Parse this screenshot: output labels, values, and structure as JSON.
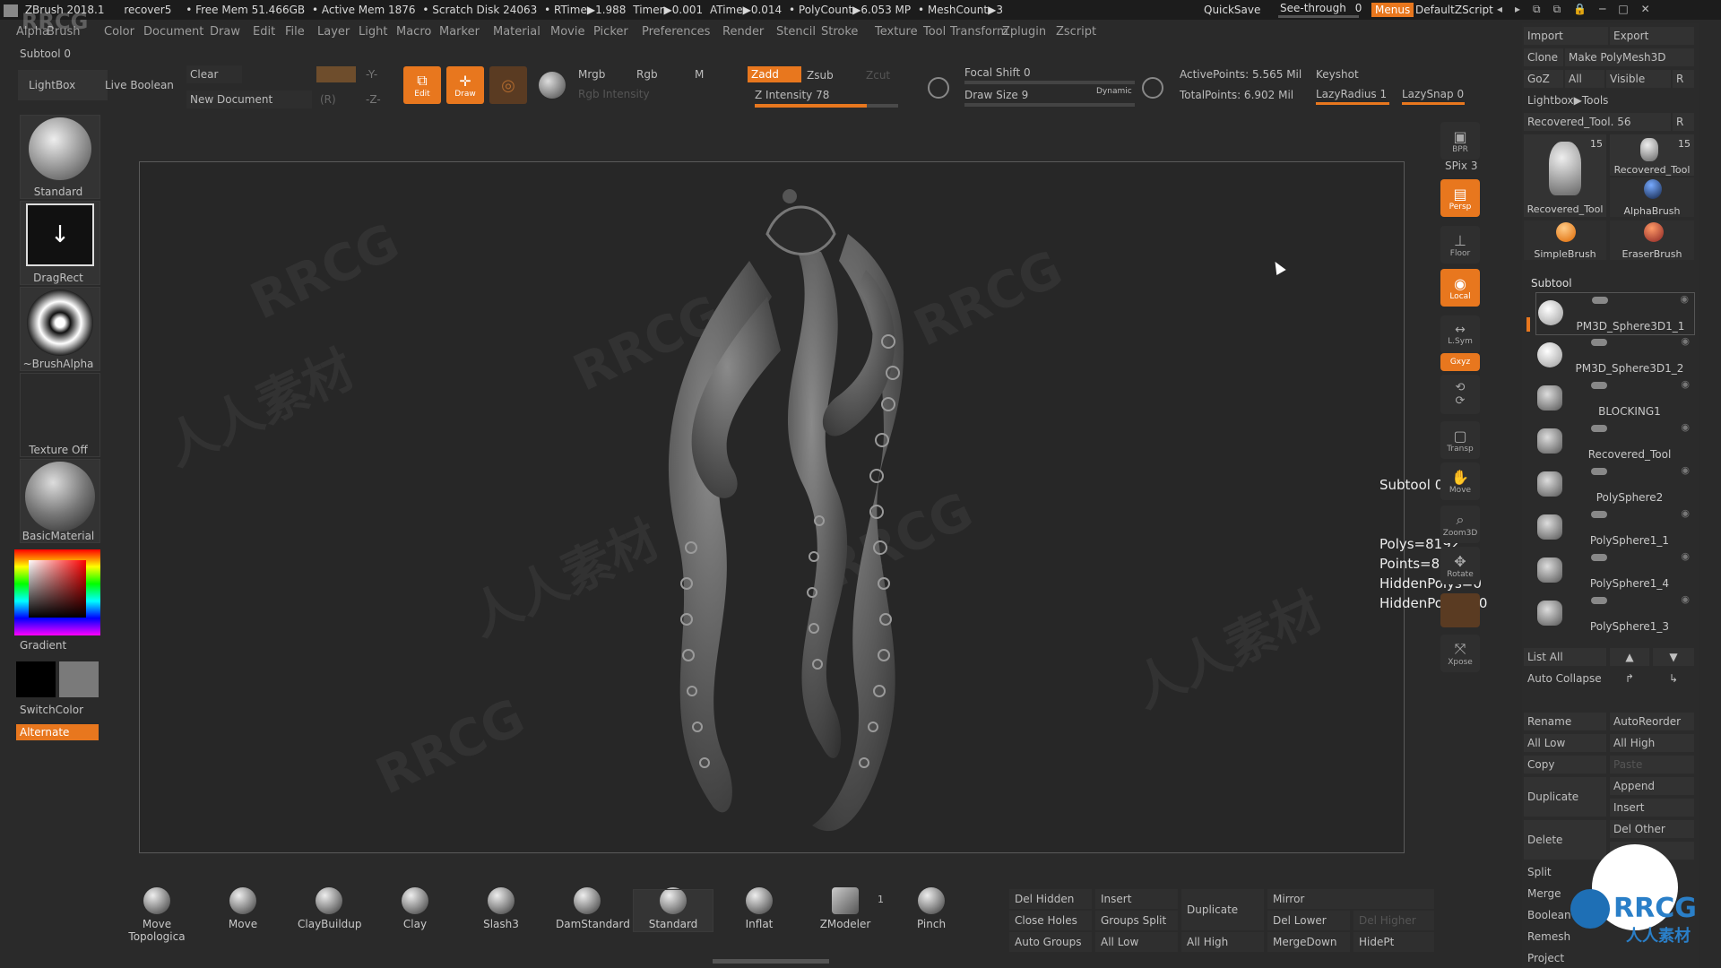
{
  "titlebar": {
    "app": "ZBrush 2018.1",
    "file": "recover5",
    "free_mem": "• Free Mem 51.466GB",
    "active_mem": "• Active Mem 1876",
    "scratch": "• Scratch Disk 24063",
    "rtime": "• RTime▶1.988",
    "timer": "Timer▶0.001",
    "atime": "ATime▶0.014",
    "polycount": "• PolyCount▶6.053 MP",
    "meshcount": "• MeshCount▶3",
    "quicksave": "QuickSave",
    "see_through": "See-through",
    "see_through_val": "0",
    "menus": "Menus",
    "default_script": "DefaultZScript"
  },
  "menu": [
    "Alpha",
    "Brush",
    "Color",
    "Document",
    "Draw",
    "Edit",
    "File",
    "Layer",
    "Light",
    "Macro",
    "Marker",
    "Material",
    "Movie",
    "Picker",
    "Preferences",
    "Render",
    "Stencil",
    "Stroke",
    "Texture",
    "Tool",
    "Transform",
    "Zplugin",
    "Zscript"
  ],
  "toolbar": {
    "subtool_label": "Subtool 0",
    "lightbox": "LightBox",
    "live_boolean": "Live Boolean",
    "clear": "Clear",
    "new_document": "New Document",
    "edit": "Edit",
    "draw": "Draw",
    "mrgb": "Mrgb",
    "rgb": "Rgb",
    "m": "M",
    "zadd": "Zadd",
    "zsub": "Zsub",
    "zcut": "Zcut",
    "rgb_intensity": "Rgb Intensity",
    "z_intensity": "Z Intensity 78",
    "z_intensity_value": 78,
    "focal_shift": "Focal Shift 0",
    "draw_size": "Draw Size 9",
    "dynamic": "Dynamic",
    "active_points": "ActivePoints: 5.565 Mil",
    "total_points": "TotalPoints: 6.902 Mil",
    "keyshot": "Keyshot",
    "lazy_radius": "LazyRadius 1",
    "lazy_snap": "LazySnap 0"
  },
  "left": {
    "brush": "Standard",
    "stroke": "DragRect",
    "alpha": "~BrushAlpha",
    "texture": "Texture Off",
    "material": "BasicMaterial",
    "gradient": "Gradient",
    "switch_color": "SwitchColor",
    "alternate": "Alternate"
  },
  "rail": {
    "bpr": "BPR",
    "spix": "SPix 3",
    "persp": "Persp",
    "floor": "Floor",
    "local": "Local",
    "lsym": "L.Sym",
    "xyz": "Gxyz",
    "transp": "Transp",
    "move": "Move",
    "zoom3d": "Zoom3D",
    "rotate": "Rotate",
    "xpose": "Xpose"
  },
  "canvas": {
    "subtool_label": "Subtool 0",
    "polys": "Polys=8192",
    "points": "Points=8066",
    "hidden_polys": "HiddenPolys=0",
    "hidden_points": "HiddenPoints=0",
    "watermark": "RRCG",
    "watermark2": "人人素材"
  },
  "right": {
    "import": "Import",
    "export": "Export",
    "clone": "Clone",
    "make_polymesh": "Make PolyMesh3D",
    "goz": "GoZ",
    "all": "All",
    "visible": "Visible",
    "r": "R",
    "lightbox_tools": "Lightbox▶Tools",
    "recovered_tool": "Recovered_Tool. 56",
    "tools": [
      {
        "name": "Recovered_Tool",
        "count": "15"
      },
      {
        "name": "Recovered_Tool",
        "count": "15"
      },
      {
        "name": "AlphaBrush",
        "count": ""
      },
      {
        "name": "SimpleBrush",
        "count": ""
      },
      {
        "name": "EraserBrush",
        "count": ""
      }
    ],
    "subtool_header": "Subtool",
    "subtools": [
      "PM3D_Sphere3D1_1",
      "PM3D_Sphere3D1_2",
      "BLOCKING1",
      "Recovered_Tool",
      "PolySphere2",
      "PolySphere1_1",
      "PolySphere1_4",
      "PolySphere1_3"
    ],
    "list_all": "List All",
    "auto_collapse": "Auto Collapse",
    "rename": "Rename",
    "auto_reorder": "AutoReorder",
    "all_low": "All Low",
    "all_high": "All High",
    "copy": "Copy",
    "paste": "Paste",
    "duplicate": "Duplicate",
    "append": "Append",
    "insert": "Insert",
    "del_other": "Del Other",
    "delete": "Delete",
    "split": "Split",
    "merge": "Merge",
    "boolean": "Boolean",
    "remesh": "Remesh",
    "project": "Project"
  },
  "brushes": [
    "Move Topologica",
    "Move",
    "ClayBuildup",
    "Clay",
    "Slash3",
    "DamStandard",
    "Standard",
    "Inflat",
    "ZModeler",
    "Pinch"
  ],
  "zmodeler_count": "1",
  "bottom": {
    "del_hidden": "Del Hidden",
    "insert": "Insert",
    "duplicate": "Duplicate",
    "mirror": "Mirror",
    "close_holes": "Close Holes",
    "groups_split": "Groups Split",
    "del_lower": "Del Lower",
    "del_higher": "Del Higher",
    "auto_groups": "Auto Groups",
    "all_low": "All Low",
    "all_high": "All High",
    "merge_down": "MergeDown",
    "hide_pt": "HidePt"
  },
  "colors": {
    "accent": "#e8771e"
  }
}
